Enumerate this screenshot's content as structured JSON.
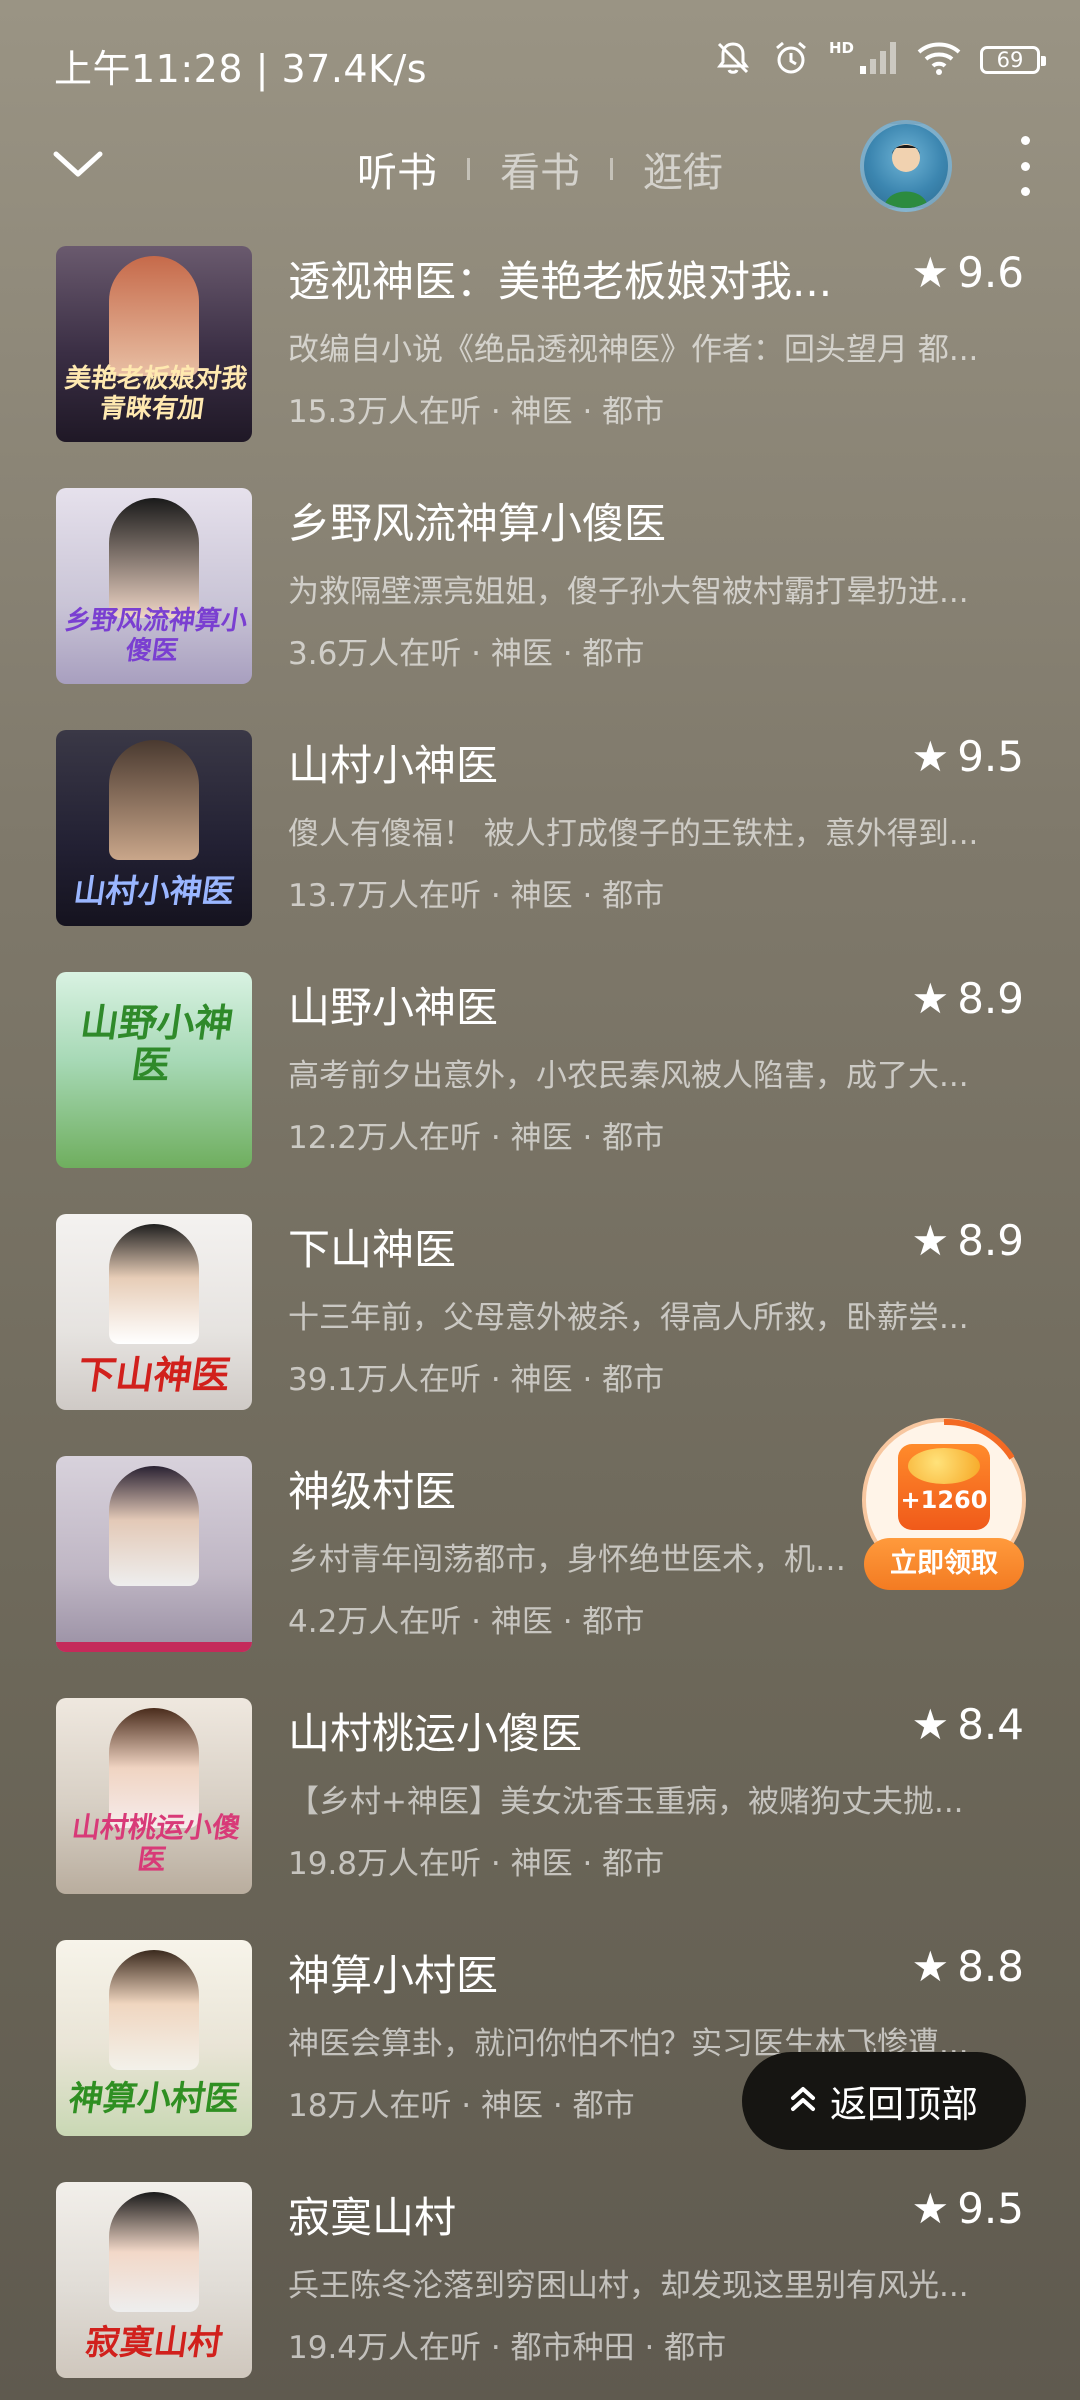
{
  "status_bar": {
    "time_speed": "上午11:28 | 37.4K/s",
    "network_label": "HD",
    "battery": "69",
    "icons": [
      "mute-bell-icon",
      "alarm-icon",
      "signal-icon",
      "wifi-icon",
      "battery-icon"
    ]
  },
  "header": {
    "tabs": [
      {
        "label": "听书",
        "active": true
      },
      {
        "label": "看书",
        "active": false
      },
      {
        "label": "逛街",
        "active": false
      }
    ]
  },
  "books": [
    {
      "title": "透视神医：美艳老板娘对我...",
      "rating": "9.6",
      "desc": "改编自小说《绝品透视神医》作者：回头望月 都...",
      "meta": "15.3万人在听 · 神医 · 都市",
      "cover_text": "美艳老板娘对我青睐有加",
      "cover_bg": "#3a2e44"
    },
    {
      "title": "乡野风流神算小傻医",
      "rating": "",
      "desc": "为救隔壁漂亮姐姐，傻子孙大智被村霸打晕扔进...",
      "meta": "3.6万人在听 · 神医 · 都市",
      "cover_text": "乡野风流神算小傻医",
      "cover_bg": "#c9c4d6"
    },
    {
      "title": "山村小神医",
      "rating": "9.5",
      "desc": "傻人有傻福！ 被人打成傻子的王铁柱，意外得到...",
      "meta": "13.7万人在听 · 神医 · 都市",
      "cover_text": "山村小神医",
      "cover_bg": "#222033"
    },
    {
      "title": "山野小神医",
      "rating": "8.9",
      "desc": "高考前夕出意外，小农民秦风被人陷害，成了大...",
      "meta": "12.2万人在听 · 神医 · 都市",
      "cover_text": "山野小神医",
      "cover_bg": "#8fc7a4"
    },
    {
      "title": "下山神医",
      "rating": "8.9",
      "desc": "十三年前，父母意外被杀，得高人所救，卧薪尝...",
      "meta": "39.1万人在听 · 神医 · 都市",
      "cover_text": "下山神医",
      "cover_bg": "#e6e3e0"
    },
    {
      "title": "神级村医",
      "rating": "",
      "desc": "乡村青年闯荡都市，身怀绝世医术，机缘...",
      "meta": "4.2万人在听 · 神医 · 都市",
      "cover_text": "",
      "cover_bg": "#bfb6c4"
    },
    {
      "title": "山村桃运小傻医",
      "rating": "8.4",
      "desc": "【乡村+神医】美女沈香玉重病，被赌狗丈夫抛...",
      "meta": "19.8万人在听 · 神医 · 都市",
      "cover_text": "山村桃运小傻医",
      "cover_bg": "#d7cfc4"
    },
    {
      "title": "神算小村医",
      "rating": "8.8",
      "desc": "神医会算卦，就问你怕不怕？实习医生林飞惨遭...",
      "meta": "18万人在听 · 神医 · 都市",
      "cover_text": "神算小村医",
      "cover_bg": "#e9e4d6"
    },
    {
      "title": "寂寞山村",
      "rating": "9.5",
      "desc": "兵王陈冬沦落到穷困山村，却发现这里别有风光...",
      "meta": "19.4万人在听 · 都市种田 · 都市",
      "cover_text": "寂寞山村",
      "cover_bg": "#e0dcd6"
    }
  ],
  "reward": {
    "amount": "+1260",
    "button_label": "立即领取"
  },
  "back_to_top": {
    "label": "返回顶部"
  }
}
